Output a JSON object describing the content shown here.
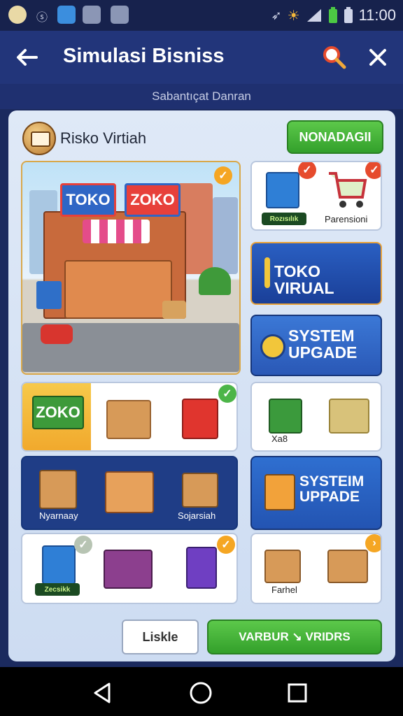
{
  "status_bar": {
    "time": "11:00"
  },
  "app_bar": {
    "title": "Simulasi Bisniss"
  },
  "subheader": {
    "text": "Sabantıçat Danran"
  },
  "panel": {
    "title": "Risko Virtiah",
    "header_button": "NONADAGII",
    "scene": {
      "sign_left": "TOKO",
      "sign_right": "ZOKO"
    },
    "tile_market": {
      "badge": "Rozısılık",
      "label": "Parensioni"
    },
    "tile_toko": {
      "label": "TOKO VIRUAL"
    },
    "tile_system1": {
      "label": "SYSTEM UPGADE"
    },
    "row1_left": {
      "logo": "ZOKO"
    },
    "row1_right": {
      "label": "Xa8"
    },
    "row2_left": {
      "label_left": "Nyarnaay",
      "label_right": "Sojarsiah"
    },
    "row2_right": {
      "label": "SYSTEIM UPPADE"
    },
    "row3_left": {
      "badge": "Zecsikk"
    },
    "row3_right": {
      "label": "Farhel"
    },
    "footer": {
      "cancel": "Liskle",
      "confirm": "VARBUR ↘ VRIDRS"
    }
  },
  "colors": {
    "accent_green": "#3fb336",
    "navy": "#22357a",
    "check_orange": "#f5a623",
    "check_red": "#e64b2d"
  }
}
